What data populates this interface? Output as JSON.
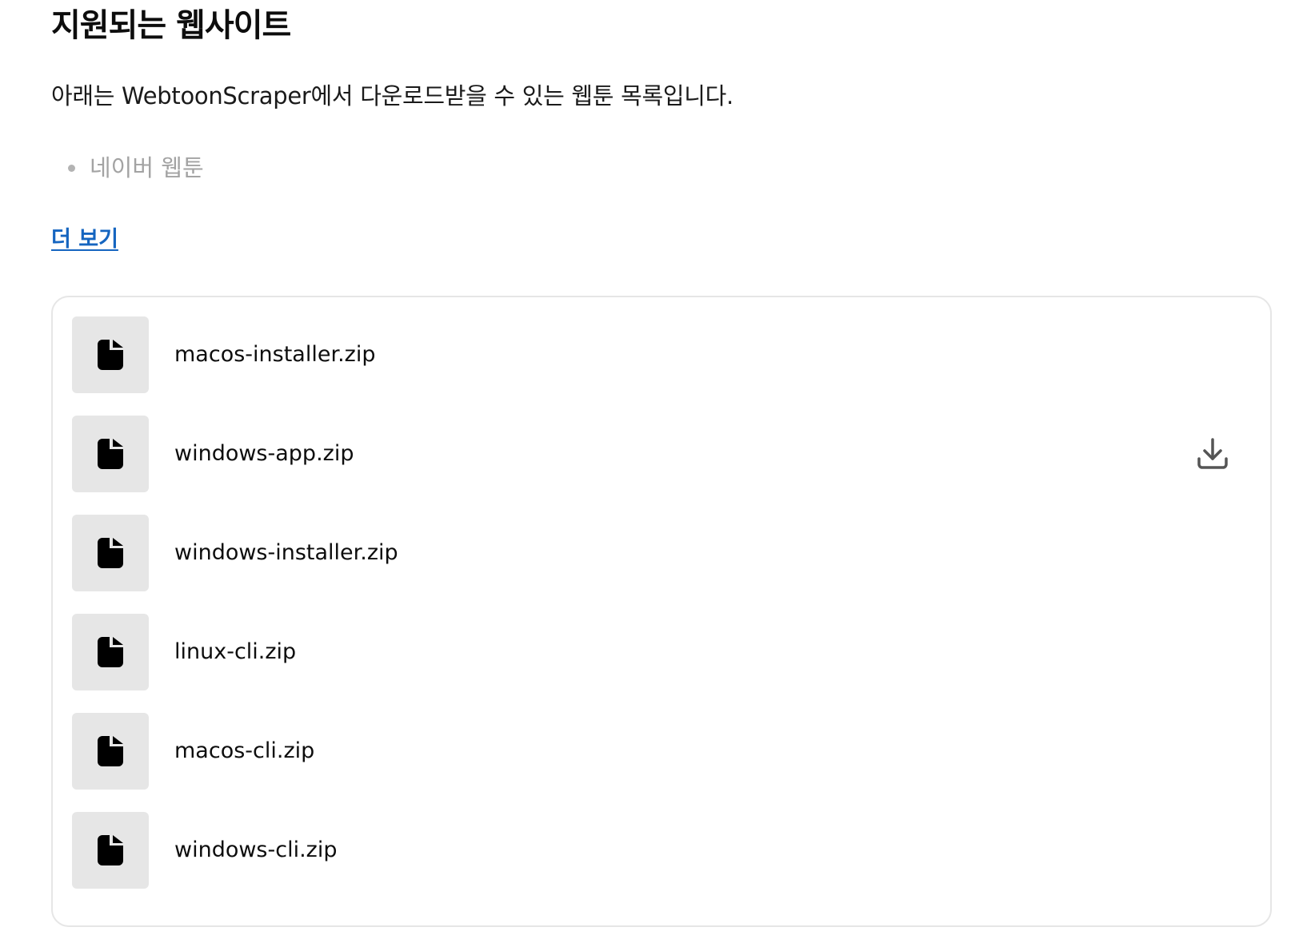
{
  "heading": "지원되는 웹사이트",
  "intro": "아래는 WebtoonScraper에서 다운로드받을 수 있는 웹툰 목록입니다.",
  "sites": [
    {
      "label": "네이버 웹툰"
    }
  ],
  "more_link": "더 보기",
  "files": [
    {
      "name": "macos-installer.zip"
    },
    {
      "name": "windows-app.zip",
      "download_icon_visible": true
    },
    {
      "name": "windows-installer.zip"
    },
    {
      "name": "linux-cli.zip"
    },
    {
      "name": "macos-cli.zip"
    },
    {
      "name": "windows-cli.zip"
    }
  ],
  "icons": {
    "file": "file-icon",
    "download": "download-icon"
  },
  "colors": {
    "link": "#1565c0",
    "muted_text": "#a3a3a3",
    "thumb_bg": "#e6e6e6",
    "card_border": "#e6e6e6"
  }
}
